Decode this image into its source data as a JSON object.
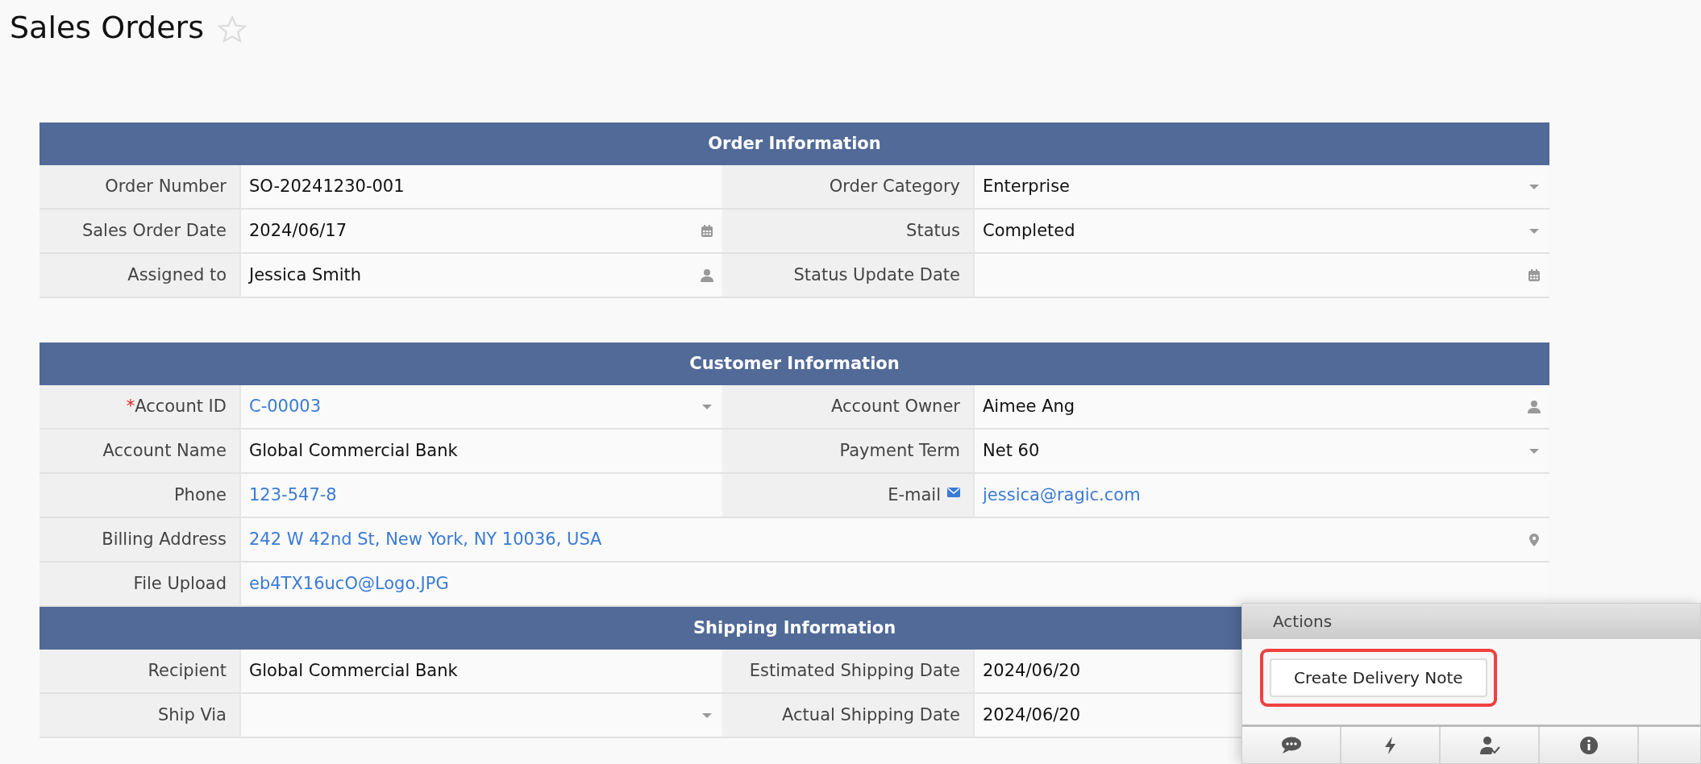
{
  "page": {
    "title": "Sales Orders",
    "favorite": false
  },
  "sections": [
    {
      "title": "Order Information",
      "rows": [
        {
          "fields": [
            {
              "label": "Order Number",
              "value": "SO-20241230-001",
              "kind": "text"
            },
            {
              "label": "Order Category",
              "value": "Enterprise",
              "kind": "select"
            }
          ]
        },
        {
          "fields": [
            {
              "label": "Sales Order Date",
              "value": "2024/06/17",
              "kind": "date"
            },
            {
              "label": "Status",
              "value": "Completed",
              "kind": "select"
            }
          ]
        },
        {
          "fields": [
            {
              "label": "Assigned to",
              "value": "Jessica Smith",
              "kind": "user"
            },
            {
              "label": "Status Update Date",
              "kind": "date"
            }
          ]
        }
      ]
    },
    {
      "title": "Customer Information",
      "rows": [
        {
          "fields": [
            {
              "label": "Account ID",
              "required_mark": "*",
              "value": "C-00003",
              "link": true,
              "kind": "select"
            },
            {
              "label": "Account Owner",
              "value": "Aimee Ang",
              "kind": "user"
            }
          ]
        },
        {
          "fields": [
            {
              "label": "Account Name",
              "value": "Global Commercial Bank",
              "kind": "text"
            },
            {
              "label": "Payment Term",
              "value": "Net 60",
              "kind": "select"
            }
          ]
        },
        {
          "fields": [
            {
              "label": "Phone",
              "value": "123-547-8",
              "link": true,
              "kind": "text"
            },
            {
              "label": "E-mail",
              "value": "jessica@ragic.com",
              "link": true,
              "kind": "email"
            }
          ]
        },
        {
          "fields": [
            {
              "label": "Billing Address",
              "value": "242 W 42nd St, New York, NY 10036, USA",
              "link": true,
              "kind": "address"
            }
          ]
        },
        {
          "fields": [
            {
              "label": "File Upload",
              "value": "eb4TX16ucO@Logo.JPG",
              "link": true,
              "kind": "text"
            }
          ]
        }
      ]
    },
    {
      "title": "Shipping Information",
      "rows": [
        {
          "fields": [
            {
              "label": "Recipient",
              "value": "Global Commercial Bank",
              "kind": "text"
            },
            {
              "label": "Estimated Shipping Date",
              "value": "2024/06/20",
              "kind": "text"
            }
          ]
        },
        {
          "fields": [
            {
              "label": "Ship Via",
              "kind": "select"
            },
            {
              "label": "Actual Shipping Date",
              "value": "2024/06/20",
              "kind": "text"
            }
          ]
        }
      ]
    }
  ],
  "actions_panel": {
    "title": "Actions",
    "buttons": [
      {
        "label": "Create Delivery Note",
        "highlighted": true
      }
    ],
    "toolbar": [
      {
        "kind": "comment"
      },
      {
        "kind": "bolt"
      },
      {
        "kind": "user-check"
      },
      {
        "kind": "info"
      }
    ]
  }
}
